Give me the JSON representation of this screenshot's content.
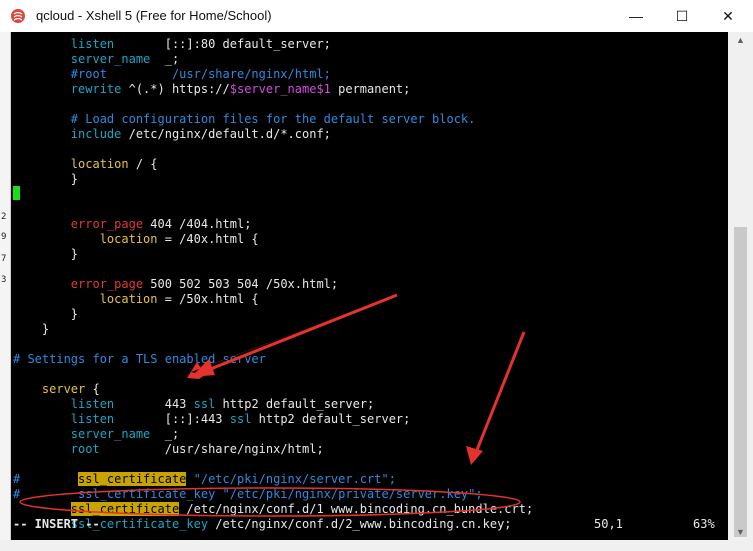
{
  "window": {
    "title": "qcloud - Xshell 5 (Free for Home/School)",
    "minimize_glyph": "—",
    "maximize_glyph": "☐",
    "close_glyph": "✕",
    "app_icon": "xshell-logo"
  },
  "gutter": {
    "numbers": [
      "2",
      "9",
      "7",
      "3"
    ]
  },
  "editor": {
    "lines": [
      {
        "indent": "        ",
        "parts": [
          {
            "t": "listen",
            "c": "c-cyan"
          },
          {
            "t": "       [::]:80 default_server;",
            "c": "c-white"
          }
        ]
      },
      {
        "indent": "        ",
        "parts": [
          {
            "t": "server_name",
            "c": "c-cyan"
          },
          {
            "t": "  _;",
            "c": "c-white"
          }
        ]
      },
      {
        "indent": "        ",
        "parts": [
          {
            "t": "#root         /usr/share/nginx/html;",
            "c": "c-teal-comment"
          }
        ]
      },
      {
        "indent": "        ",
        "parts": [
          {
            "t": "rewrite",
            "c": "c-cyan"
          },
          {
            "t": " ^(.*) https://",
            "c": "c-white"
          },
          {
            "t": "$server_name$1",
            "c": "c-pink"
          },
          {
            "t": " permanent;",
            "c": "c-white"
          }
        ]
      },
      {
        "indent": "",
        "parts": []
      },
      {
        "indent": "        ",
        "parts": [
          {
            "t": "# Load configuration files for the default server block.",
            "c": "c-teal-comment"
          }
        ]
      },
      {
        "indent": "        ",
        "parts": [
          {
            "t": "include",
            "c": "c-cyan"
          },
          {
            "t": " /etc/nginx/default.d/*.conf;",
            "c": "c-white"
          }
        ]
      },
      {
        "indent": "",
        "parts": []
      },
      {
        "indent": "        ",
        "parts": [
          {
            "t": "location",
            "c": "c-yellow"
          },
          {
            "t": " / {",
            "c": "c-white"
          }
        ]
      },
      {
        "indent": "        ",
        "parts": [
          {
            "t": "}",
            "c": "c-white"
          }
        ]
      },
      {
        "indent": "",
        "parts": []
      },
      {
        "indent": "",
        "parts": []
      },
      {
        "indent": "        ",
        "parts": [
          {
            "t": "error_page",
            "c": "c-red"
          },
          {
            "t": " 404 /404.html;",
            "c": "c-white"
          }
        ]
      },
      {
        "indent": "            ",
        "parts": [
          {
            "t": "location",
            "c": "c-yellow"
          },
          {
            "t": " = /40x.html {",
            "c": "c-white"
          }
        ]
      },
      {
        "indent": "        ",
        "parts": [
          {
            "t": "}",
            "c": "c-white"
          }
        ]
      },
      {
        "indent": "",
        "parts": []
      },
      {
        "indent": "        ",
        "parts": [
          {
            "t": "error_page",
            "c": "c-red"
          },
          {
            "t": " 500 502 503 504 /50x.html;",
            "c": "c-white"
          }
        ]
      },
      {
        "indent": "            ",
        "parts": [
          {
            "t": "location",
            "c": "c-yellow"
          },
          {
            "t": " = /50x.html {",
            "c": "c-white"
          }
        ]
      },
      {
        "indent": "        ",
        "parts": [
          {
            "t": "}",
            "c": "c-white"
          }
        ]
      },
      {
        "indent": "    ",
        "parts": [
          {
            "t": "}",
            "c": "c-white"
          }
        ]
      },
      {
        "indent": "",
        "parts": []
      },
      {
        "indent": "",
        "parts": [
          {
            "t": "# Settings for a TLS enabled server",
            "c": "c-teal-comment"
          }
        ]
      },
      {
        "indent": "",
        "parts": []
      },
      {
        "indent": "    ",
        "parts": [
          {
            "t": "server",
            "c": "c-yellow"
          },
          {
            "t": " {",
            "c": "c-white"
          }
        ]
      },
      {
        "indent": "        ",
        "parts": [
          {
            "t": "listen",
            "c": "c-cyan"
          },
          {
            "t": "       443 ",
            "c": "c-white"
          },
          {
            "t": "ssl",
            "c": "c-cyan"
          },
          {
            "t": " http2 default_server;",
            "c": "c-white"
          }
        ]
      },
      {
        "indent": "        ",
        "parts": [
          {
            "t": "listen",
            "c": "c-cyan"
          },
          {
            "t": "       [::]:443 ",
            "c": "c-white"
          },
          {
            "t": "ssl",
            "c": "c-cyan"
          },
          {
            "t": " http2 default_server;",
            "c": "c-white"
          }
        ]
      },
      {
        "indent": "        ",
        "parts": [
          {
            "t": "server_name",
            "c": "c-cyan"
          },
          {
            "t": "  _;",
            "c": "c-white"
          }
        ]
      },
      {
        "indent": "        ",
        "parts": [
          {
            "t": "root",
            "c": "c-cyan"
          },
          {
            "t": "         /usr/share/nginx/html;",
            "c": "c-white"
          }
        ]
      },
      {
        "indent": "",
        "parts": []
      },
      {
        "indent": "",
        "parts": [
          {
            "t": "#        ",
            "c": "c-teal-comment"
          },
          {
            "t": "ssl_certificate",
            "c": "hl"
          },
          {
            "t": " \"/etc/pki/nginx/server.crt\";",
            "c": "c-teal-comment"
          }
        ]
      },
      {
        "indent": "",
        "parts": [
          {
            "t": "#        ssl_certificate_key \"/etc/pki/nginx/private/server.key\";",
            "c": "c-teal-comment"
          }
        ]
      },
      {
        "indent": "        ",
        "parts": [
          {
            "t": "ssl_certificate",
            "c": "hl"
          },
          {
            "t": " /etc/nginx/conf.d/1_www.bincoding.cn_bundle.crt;",
            "c": "c-white"
          }
        ]
      },
      {
        "indent": "        ",
        "parts": [
          {
            "t": "ssl_certificate_key",
            "c": "c-cyan"
          },
          {
            "t": " /etc/nginx/conf.d/2_www.bincoding.cn.key;",
            "c": "c-white"
          }
        ]
      }
    ]
  },
  "status_bar": {
    "mode": "-- INSERT --",
    "position": "50,1",
    "percent": "63%"
  },
  "colors": {
    "terminal_bg": "#000000",
    "annotation_red": "#e5322d",
    "cursor": "#18e018"
  }
}
